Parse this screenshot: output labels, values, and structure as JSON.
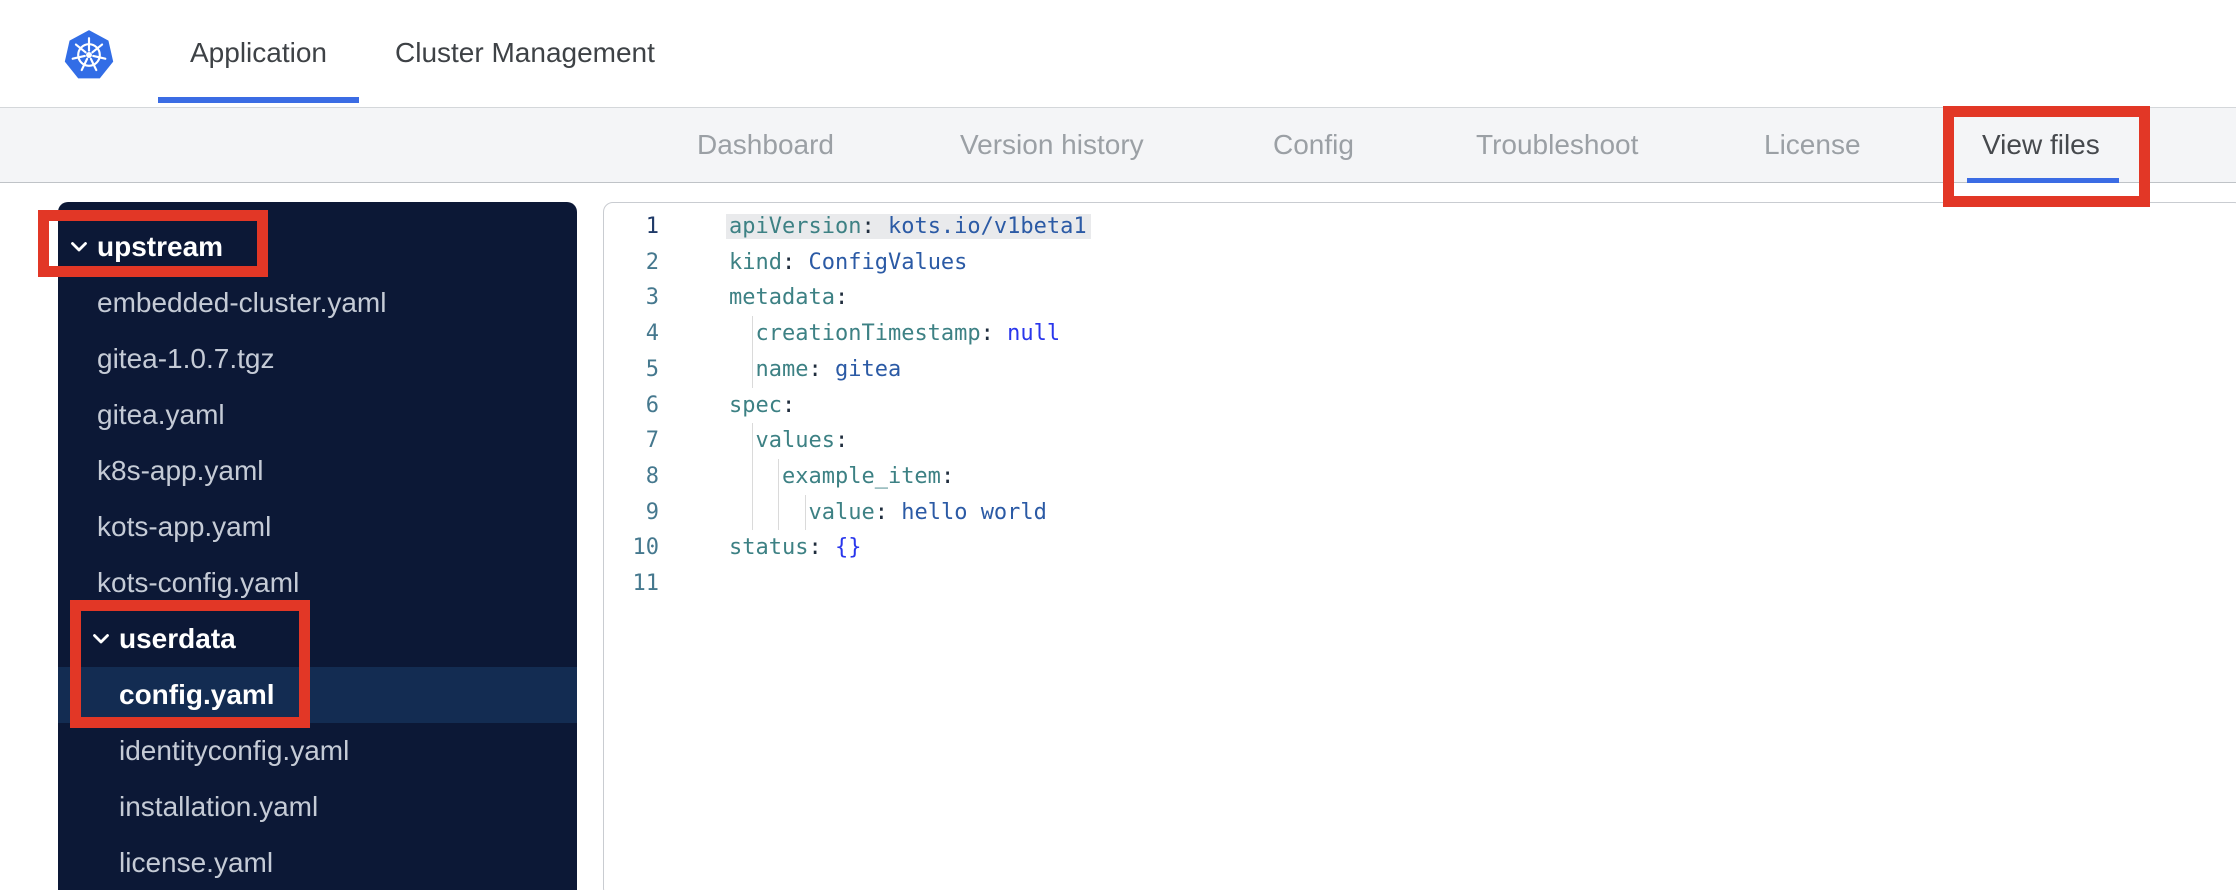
{
  "header": {
    "tabs": [
      {
        "label": "Application",
        "active": true
      },
      {
        "label": "Cluster Management",
        "active": false
      }
    ]
  },
  "subnav": {
    "items": [
      {
        "label": "Dashboard",
        "active": false
      },
      {
        "label": "Version history",
        "active": false
      },
      {
        "label": "Config",
        "active": false
      },
      {
        "label": "Troubleshoot",
        "active": false
      },
      {
        "label": "License",
        "active": false
      },
      {
        "label": "View files",
        "active": true
      }
    ]
  },
  "file_tree": {
    "items": [
      {
        "label": "upstream",
        "type": "folder",
        "level": 0,
        "expanded": true
      },
      {
        "label": "embedded-cluster.yaml",
        "type": "file",
        "level": 1
      },
      {
        "label": "gitea-1.0.7.tgz",
        "type": "file",
        "level": 1
      },
      {
        "label": "gitea.yaml",
        "type": "file",
        "level": 1
      },
      {
        "label": "k8s-app.yaml",
        "type": "file",
        "level": 1
      },
      {
        "label": "kots-app.yaml",
        "type": "file",
        "level": 1
      },
      {
        "label": "kots-config.yaml",
        "type": "file",
        "level": 1
      },
      {
        "label": "userdata",
        "type": "folder",
        "level": 1,
        "expanded": true
      },
      {
        "label": "config.yaml",
        "type": "file",
        "level": 2,
        "selected": true
      },
      {
        "label": "identityconfig.yaml",
        "type": "file",
        "level": 2
      },
      {
        "label": "installation.yaml",
        "type": "file",
        "level": 2
      },
      {
        "label": "license.yaml",
        "type": "file",
        "level": 2
      }
    ]
  },
  "editor": {
    "language": "yaml",
    "lines": [
      {
        "n": 1,
        "indent": 0,
        "selected": true,
        "tokens": [
          {
            "c": "key",
            "t": "apiVersion"
          },
          {
            "c": "punc",
            "t": ": "
          },
          {
            "c": "str",
            "t": "kots.io/v1beta1"
          }
        ]
      },
      {
        "n": 2,
        "indent": 0,
        "tokens": [
          {
            "c": "key",
            "t": "kind"
          },
          {
            "c": "punc",
            "t": ": "
          },
          {
            "c": "str",
            "t": "ConfigValues"
          }
        ]
      },
      {
        "n": 3,
        "indent": 0,
        "tokens": [
          {
            "c": "key",
            "t": "metadata"
          },
          {
            "c": "punc",
            "t": ":"
          }
        ]
      },
      {
        "n": 4,
        "indent": 2,
        "tokens": [
          {
            "c": "key",
            "t": "creationTimestamp"
          },
          {
            "c": "punc",
            "t": ": "
          },
          {
            "c": "kw",
            "t": "null"
          }
        ]
      },
      {
        "n": 5,
        "indent": 2,
        "tokens": [
          {
            "c": "key",
            "t": "name"
          },
          {
            "c": "punc",
            "t": ": "
          },
          {
            "c": "str",
            "t": "gitea"
          }
        ]
      },
      {
        "n": 6,
        "indent": 0,
        "tokens": [
          {
            "c": "key",
            "t": "spec"
          },
          {
            "c": "punc",
            "t": ":"
          }
        ]
      },
      {
        "n": 7,
        "indent": 2,
        "tokens": [
          {
            "c": "key",
            "t": "values"
          },
          {
            "c": "punc",
            "t": ":"
          }
        ]
      },
      {
        "n": 8,
        "indent": 4,
        "tokens": [
          {
            "c": "key",
            "t": "example_item"
          },
          {
            "c": "punc",
            "t": ":"
          }
        ]
      },
      {
        "n": 9,
        "indent": 6,
        "tokens": [
          {
            "c": "key",
            "t": "value"
          },
          {
            "c": "punc",
            "t": ": "
          },
          {
            "c": "str",
            "t": "hello world"
          }
        ]
      },
      {
        "n": 10,
        "indent": 0,
        "tokens": [
          {
            "c": "key",
            "t": "status"
          },
          {
            "c": "punc",
            "t": ": "
          },
          {
            "c": "kw",
            "t": "{}"
          }
        ]
      },
      {
        "n": 11,
        "indent": 0,
        "tokens": []
      }
    ]
  },
  "annotations": [
    {
      "target": "upstream folder"
    },
    {
      "target": "userdata folder and config.yaml file"
    },
    {
      "target": "View files tab"
    }
  ],
  "colors": {
    "accent_blue": "#3b6ce4",
    "logo_blue": "#326de6",
    "sidebar_bg": "#0c1836",
    "sidebar_selected_bg": "#132c52",
    "annotation_red": "#e23726",
    "code_key": "#3d8184",
    "code_value": "#2b5aa5",
    "code_keyword": "#2936ec",
    "code_punct": "#1f2d3d",
    "gutter_number": "#45788e",
    "gutter_number_active": "#1f3a68"
  }
}
